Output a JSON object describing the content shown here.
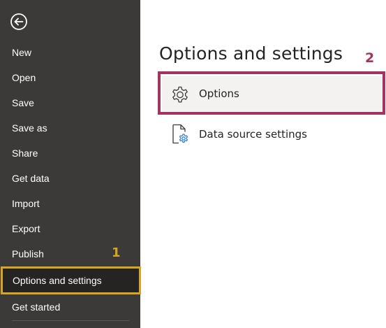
{
  "sidebar": {
    "back_icon": "back-arrow-icon",
    "items": [
      {
        "label": "New"
      },
      {
        "label": "Open"
      },
      {
        "label": "Save"
      },
      {
        "label": "Save as"
      },
      {
        "label": "Share"
      },
      {
        "label": "Get data"
      },
      {
        "label": "Import"
      },
      {
        "label": "Export"
      },
      {
        "label": "Publish"
      },
      {
        "label": "Options and settings",
        "selected": true
      },
      {
        "label": "Get started"
      }
    ]
  },
  "main": {
    "title": "Options and settings",
    "options": [
      {
        "label": "Options",
        "icon": "gear-icon",
        "highlighted": true
      },
      {
        "label": "Data source settings",
        "icon": "document-gear-icon"
      }
    ]
  },
  "annotations": {
    "callout_1": "1",
    "callout_2": "2",
    "callout_1_color": "#d6a621",
    "callout_2_color": "#a3345f"
  },
  "colors": {
    "sidebar_bg": "#3b3a39",
    "selected_bg": "#252423",
    "text_dark": "#252423"
  }
}
